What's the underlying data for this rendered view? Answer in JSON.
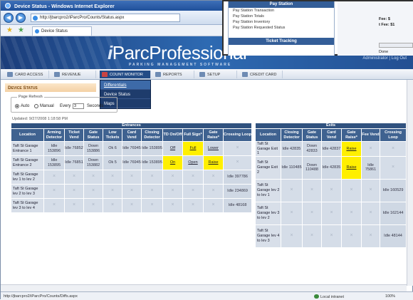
{
  "window": {
    "title": "Device Status - Windows Internet Explorer"
  },
  "address": {
    "url": "http://jbarcpro2/iParcPro/Counts/Status.aspx"
  },
  "tab": {
    "label": "Device Status"
  },
  "banner": {
    "logo_i": "i",
    "logo_text": "Parc",
    "logo_rest": "Professional",
    "logo_reg": "®",
    "subtitle": "PARKING MANAGEMENT SOFTWARE",
    "admin": "Administrator | Log Out"
  },
  "menu": {
    "items": [
      {
        "label": "CARD ACCESS"
      },
      {
        "label": "REVENUE"
      },
      {
        "label": "COUNT MONITOR"
      },
      {
        "label": "REPORTS"
      },
      {
        "label": "SETUP"
      },
      {
        "label": "CREDIT CARD"
      }
    ],
    "dropdown": [
      "Differentials",
      "Device Status",
      "Maps"
    ]
  },
  "page": {
    "title": "Device Status",
    "refresh_legend": "Page Refresh",
    "auto_label": "Auto",
    "manual_label": "Manual",
    "every_label": "Every",
    "every_value": "3",
    "seconds_label": "Seconds",
    "updated": "Updated: 9/27/2008 1:18:58 PM"
  },
  "entrances": {
    "group": "Entrances",
    "columns": [
      "Location",
      "Arming Detector",
      "Ticket Vend",
      "Gate Status",
      "Low Tickets",
      "Card Vend",
      "Closing Detector",
      "TD On/Off",
      "Full Sign*",
      "Gate Raise*",
      "Crossing Loop"
    ],
    "rows": [
      [
        "Taft St Garage Entrance 1",
        "Idle 153896",
        "Idle 76852",
        "Down 153886",
        "Ok 6",
        "Idle 76945",
        "Idle 153895",
        "Off",
        "Full",
        "Lower",
        ""
      ],
      [
        "Taft St Garage Entrance 2",
        "Idle 153895",
        "Idle 76851",
        "Down 153882",
        "Ok 5",
        "Idle 76945",
        "Idle 153895",
        "On",
        "Open",
        "Raise",
        ""
      ],
      [
        "Taft St Garage lev 1 to lev 2",
        "",
        "",
        "",
        "",
        "",
        "",
        "",
        "",
        "",
        "Idle 397786"
      ],
      [
        "Taft St Garage lev 2 to lev 3",
        "",
        "",
        "",
        "",
        "",
        "",
        "",
        "",
        "",
        "Idle 234869"
      ],
      [
        "Taft St Garage lev 3 to lev 4",
        "",
        "",
        "",
        "",
        "",
        "",
        "",
        "",
        "",
        "Idle 48168"
      ]
    ],
    "highlight": [
      [
        0,
        8
      ],
      [
        1,
        7
      ],
      [
        1,
        9
      ]
    ],
    "links": [
      [
        0,
        7
      ],
      [
        0,
        8
      ],
      [
        0,
        9
      ],
      [
        1,
        7
      ],
      [
        1,
        8
      ],
      [
        1,
        9
      ]
    ]
  },
  "exits": {
    "group": "Exits",
    "columns": [
      "Location",
      "Closing Detector",
      "Gate Status",
      "Card Vend",
      "Gate Raise*",
      "Fee Vend",
      "Crossing Loop"
    ],
    "rows": [
      [
        "Taft St Garage Exit 1",
        "Idle 42835",
        "Down 42833",
        "Idle 42837",
        "Raise",
        "",
        ""
      ],
      [
        "Taft St Garage Exit 2",
        "Idle 110485",
        "Down 110488",
        "Idle 42835",
        "Raise",
        "Idle 75861",
        ""
      ],
      [
        "Taft St Garage lev 2 to lev 1",
        "",
        "",
        "",
        "",
        "",
        "Idle 160529"
      ],
      [
        "Taft St Garage lev 3 to lev 2",
        "",
        "",
        "",
        "",
        "",
        "Idle 162144"
      ],
      [
        "Taft St Garage lev 4 to lev 3",
        "",
        "",
        "",
        "",
        "",
        "Idle 48144"
      ]
    ],
    "highlight": [
      [
        0,
        4
      ],
      [
        1,
        4
      ]
    ]
  },
  "popup": {
    "head": "Pay Station",
    "items": [
      "Pay Station Transaction",
      "Pay Station Totals",
      "Pay Station Inventory",
      "Pay Station Requested Status"
    ],
    "head2": "Ticket Tracking",
    "fee1": "Fee: $",
    "fee2": "t Fee: $1",
    "done": "Done"
  },
  "status": {
    "url": "http://jbarcpro2/iParcPro/Counts/Diffs.aspx",
    "zone": "Local intranet",
    "zoom": "100%"
  },
  "empty_glyph": "×"
}
